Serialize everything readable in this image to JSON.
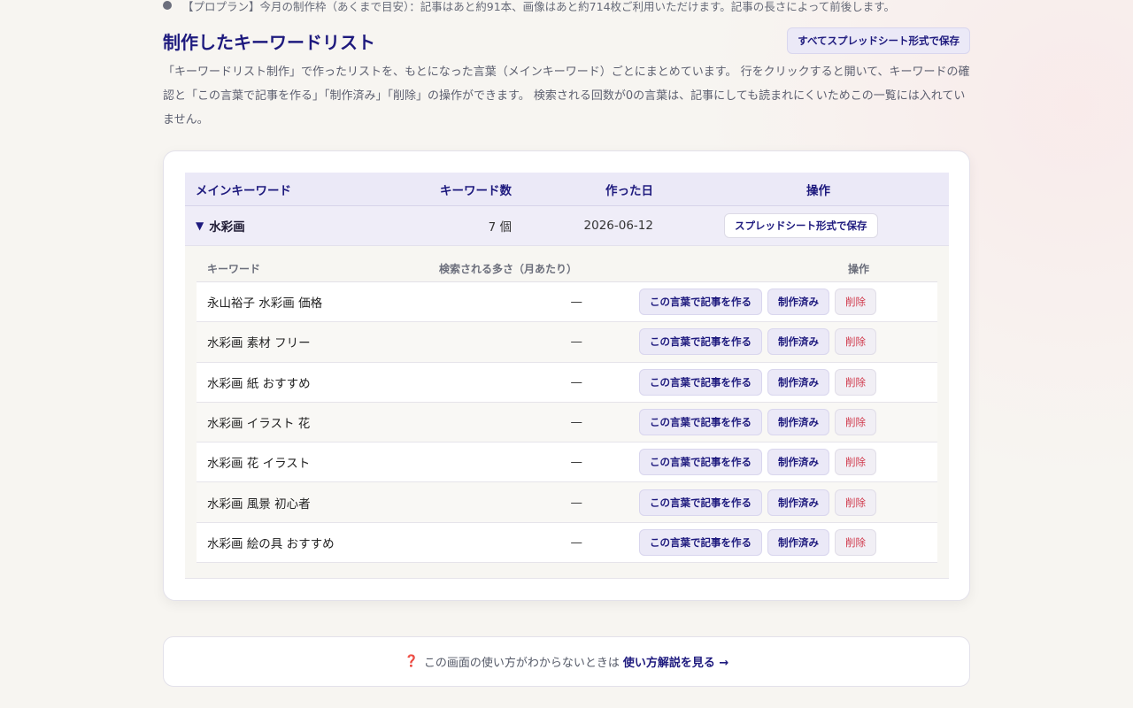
{
  "quota": {
    "text": "【プロプラン】今月の制作枠（あくまで目安）：記事はあと約91本、画像はあと約714枚ご利用いただけます。記事の長さによって前後します。"
  },
  "section": {
    "title": "制作したキーワードリスト",
    "save_all_label": "すべてスプレッドシート形式で保存",
    "description": "「キーワードリスト制作」で作ったリストを、もとになった言葉（メインキーワード）ごとにまとめています。 行をクリックすると開いて、キーワードの確認と「この言葉で記事を作る」「制作済み」「削除」の操作ができます。 検索される回数が0の言葉は、記事にしても読まれにくいためこの一覧には入れていません。"
  },
  "table": {
    "headers": {
      "main_keyword": "メインキーワード",
      "keyword_count": "キーワード数",
      "created_date": "作った日",
      "operation": "操作"
    },
    "groups": [
      {
        "expand_icon": "▼",
        "main_keyword": "水彩画",
        "count": "7 個",
        "date": "2026-06-12",
        "save_label": "スプレッドシート形式で保存",
        "sub_headers": {
          "keyword": "キーワード",
          "volume": "検索される多さ（月あたり）",
          "operation": "操作"
        },
        "rows": [
          {
            "keyword": "永山裕子 水彩画 価格",
            "volume": "—"
          },
          {
            "keyword": "水彩画 素材 フリー",
            "volume": "—"
          },
          {
            "keyword": "水彩画 紙 おすすめ",
            "volume": "—"
          },
          {
            "keyword": "水彩画 イラスト 花",
            "volume": "—"
          },
          {
            "keyword": "水彩画 花 イラスト",
            "volume": "—"
          },
          {
            "keyword": "水彩画 風景 初心者",
            "volume": "—"
          },
          {
            "keyword": "水彩画 絵の具 おすすめ",
            "volume": "—"
          }
        ],
        "row_actions": {
          "create_label": "この言葉で記事を作る",
          "done_label": "制作済み",
          "delete_label": "削除"
        }
      }
    ]
  },
  "help": {
    "icon": "❓",
    "text": "この画面の使い方がわからないときは",
    "link_label": "使い方解説を見る →"
  },
  "colors": {
    "accent": "#1e1a7e",
    "danger": "#d0384a",
    "header_bg": "#ebe9f7"
  }
}
